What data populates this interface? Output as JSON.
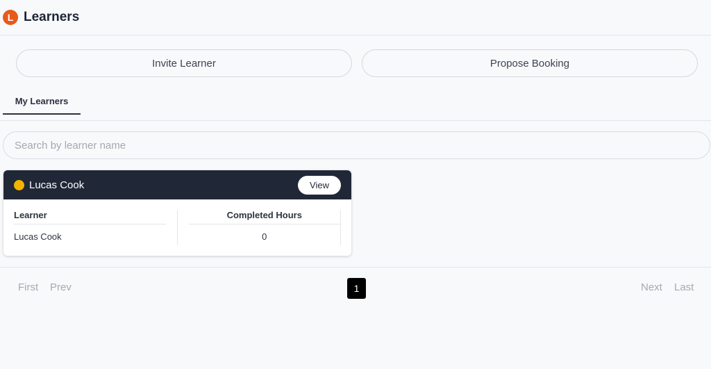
{
  "header": {
    "logo_letter": "L",
    "title": "Learners"
  },
  "actions": {
    "invite_label": "Invite Learner",
    "propose_label": "Propose Booking"
  },
  "tabs": [
    {
      "label": "My Learners",
      "active": true
    }
  ],
  "search": {
    "placeholder": "Search by learner name",
    "value": ""
  },
  "learners": [
    {
      "name": "Lucas Cook",
      "status_color": "#f3b400",
      "view_label": "View",
      "columns": {
        "learner_header": "Learner",
        "learner_value": "Lucas Cook",
        "hours_header": "Completed Hours",
        "hours_value": "0"
      }
    }
  ],
  "pagination": {
    "first": "First",
    "prev": "Prev",
    "current_page": "1",
    "next": "Next",
    "last": "Last"
  },
  "colors": {
    "brand": "#e8591a",
    "card_header": "#202838",
    "active_page": "#000000"
  }
}
